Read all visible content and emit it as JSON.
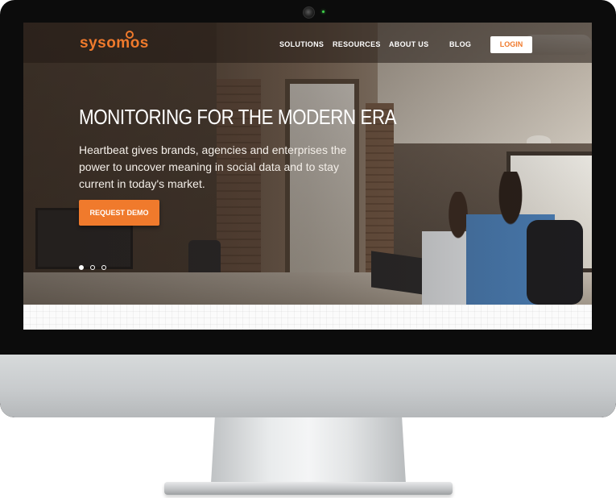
{
  "nav": {
    "logo": "sysomos",
    "items": [
      "SOLUTIONS",
      "RESOURCES",
      "ABOUT US",
      "BLOG"
    ],
    "login_label": "LOGIN"
  },
  "hero": {
    "title": "MONITORING FOR THE MODERN ERA",
    "subtitle": "Heartbeat gives brands, agencies and enterprises the power to uncover meaning in social data and to stay current in today's market.",
    "cta_label": "REQUEST DEMO",
    "slides_total": 3,
    "active_slide": 1
  },
  "colors": {
    "brand_orange": "#f07a2c",
    "nav_text": "#ffffff",
    "login_bg": "#ffffff"
  },
  "icons": {
    "camera": "webcam-icon",
    "logo_mark": "logo-bubble-icon"
  }
}
